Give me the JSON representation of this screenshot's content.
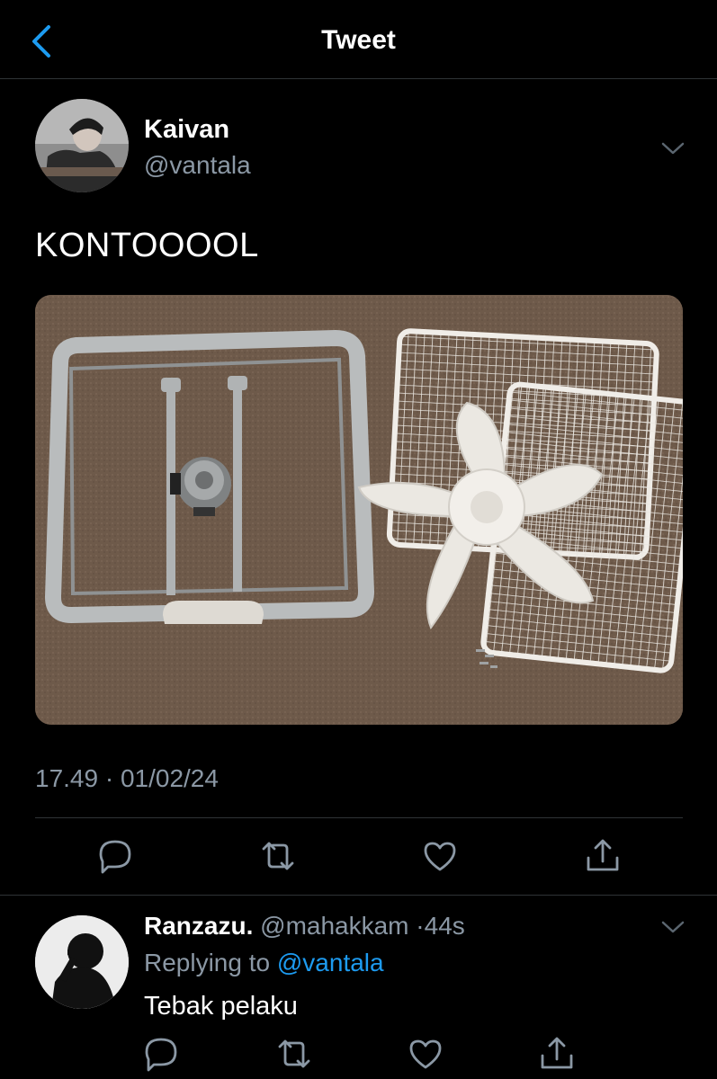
{
  "nav": {
    "title": "Tweet",
    "back_icon": "chevron-left-icon"
  },
  "tweet": {
    "author_name": "Kaivan",
    "author_handle": "@vantala",
    "text": "KONTOOOOL",
    "timestamp": "17.49 · 01/02/24",
    "media_description_icon": "photo-disassembled-box-fan",
    "actions": [
      "reply-icon",
      "retweet-icon",
      "like-icon",
      "share-icon"
    ]
  },
  "reply": {
    "author_name": "Ranzazu.",
    "author_handle": "@mahakkam",
    "separator": "·",
    "time": "44s",
    "replying_prefix": "Replying to ",
    "replying_to": "@vantala",
    "text": "Tebak pelaku"
  },
  "colors": {
    "background": "#000000",
    "muted_text": "#8b98a5",
    "accent_blue": "#1d9bf0",
    "divider": "#2f3336"
  }
}
